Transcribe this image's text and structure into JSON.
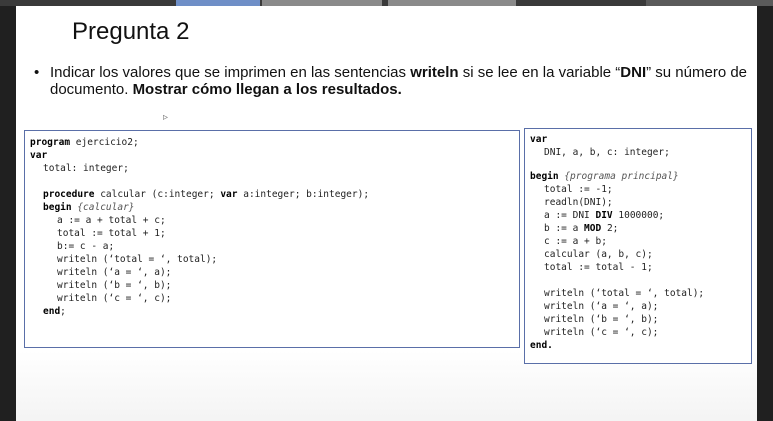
{
  "slide": {
    "title": "Pregunta 2",
    "bullet": {
      "marker": "•",
      "intro": "Indicar los valores que se imprimen en las sentencias ",
      "keyword": "writeln",
      "middle": " si se lee en la variable “",
      "variable": "DNI",
      "after": "” su número de documento. ",
      "emphasis": "Mostrar cómo llegan a los resultados."
    }
  },
  "left_code": {
    "program_kw": "program",
    "program_name": " ejercicio2;",
    "var_kw": "var",
    "total_decl": "total: integer;",
    "procedure_kw": "procedure",
    "procedure_sig_a": " calcular (c:integer; ",
    "procedure_var_kw": "var",
    "procedure_sig_b": " a:integer; b:integer);",
    "begin_kw": "begin",
    "begin_comment": " {calcular}",
    "stmt_1": "a := a + total + c;",
    "stmt_2": "total := total + 1;",
    "stmt_3": "b:= c - a;",
    "stmt_4": "writeln (‘total = ‘, total);",
    "stmt_5": "writeln (‘a = ‘, a);",
    "stmt_6": "writeln (‘b = ‘, b);",
    "stmt_7": "writeln (‘c = ‘, c);",
    "end_kw": "end",
    "end_punct": ";"
  },
  "right_code": {
    "var_kw": "var",
    "decl": "DNI, a, b, c: integer;",
    "begin_kw": "begin",
    "begin_comment": " {programa principal}",
    "stmt_1": "total := -1;",
    "stmt_2": "readln(DNI);",
    "stmt_3a": "a := DNI ",
    "stmt_3_kw": "DIV",
    "stmt_3b": " 1000000;",
    "stmt_4a": "b := a ",
    "stmt_4_kw": "MOD",
    "stmt_4b": " 2;",
    "stmt_5": "c := a + b;",
    "stmt_6": "calcular (a, b, c);",
    "stmt_7": "total := total - 1;",
    "stmt_8": "writeln (‘total = ‘, total);",
    "stmt_9": "writeln (‘a = ‘, a);",
    "stmt_10": "writeln (‘b = ‘, b);",
    "stmt_11": "writeln (‘c = ‘, c);",
    "end_kw": "end",
    "end_punct": "."
  }
}
